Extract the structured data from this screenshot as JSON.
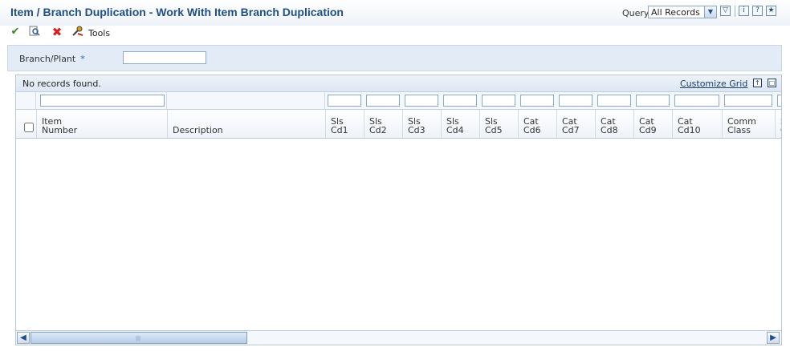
{
  "window": {
    "title": "Item / Branch Duplication - Work With Item Branch Duplication"
  },
  "header": {
    "query_label": "Query:",
    "query_value": "All Records"
  },
  "toolbar": {
    "tools_label": "Tools",
    "icons": [
      "select-checkmark-icon",
      "find-icon",
      "close-x-icon",
      "tools-icon"
    ]
  },
  "filters": {
    "branch_plant_label": "Branch/Plant",
    "required_marker": "*",
    "branch_plant_value": ""
  },
  "grid": {
    "status_text": "No records found.",
    "customize_label": "Customize Grid",
    "columns": [
      {
        "key": "item_number",
        "label": "Item\nNumber"
      },
      {
        "key": "description",
        "label": "Description"
      },
      {
        "key": "sls_cd1",
        "label": "Sls\nCd1"
      },
      {
        "key": "sls_cd2",
        "label": "Sls\nCd2"
      },
      {
        "key": "sls_cd3",
        "label": "Sls\nCd3"
      },
      {
        "key": "sls_cd4",
        "label": "Sls\nCd4"
      },
      {
        "key": "sls_cd5",
        "label": "Sls\nCd5"
      },
      {
        "key": "cat_cd6",
        "label": "Cat\nCd6"
      },
      {
        "key": "cat_cd7",
        "label": "Cat\nCd7"
      },
      {
        "key": "cat_cd8",
        "label": "Cat\nCd8"
      },
      {
        "key": "cat_cd9",
        "label": "Cat\nCd9"
      },
      {
        "key": "cat_cd10",
        "label": "Cat\nCd10"
      },
      {
        "key": "comm_class",
        "label": "Comm\nClass"
      },
      {
        "key": "partial",
        "label": "S\nC"
      }
    ],
    "rows": []
  },
  "colors": {
    "title_blue": "#1f4f86",
    "panel_blue": "#e2ebf6",
    "border_blue": "#8fa7c2"
  }
}
